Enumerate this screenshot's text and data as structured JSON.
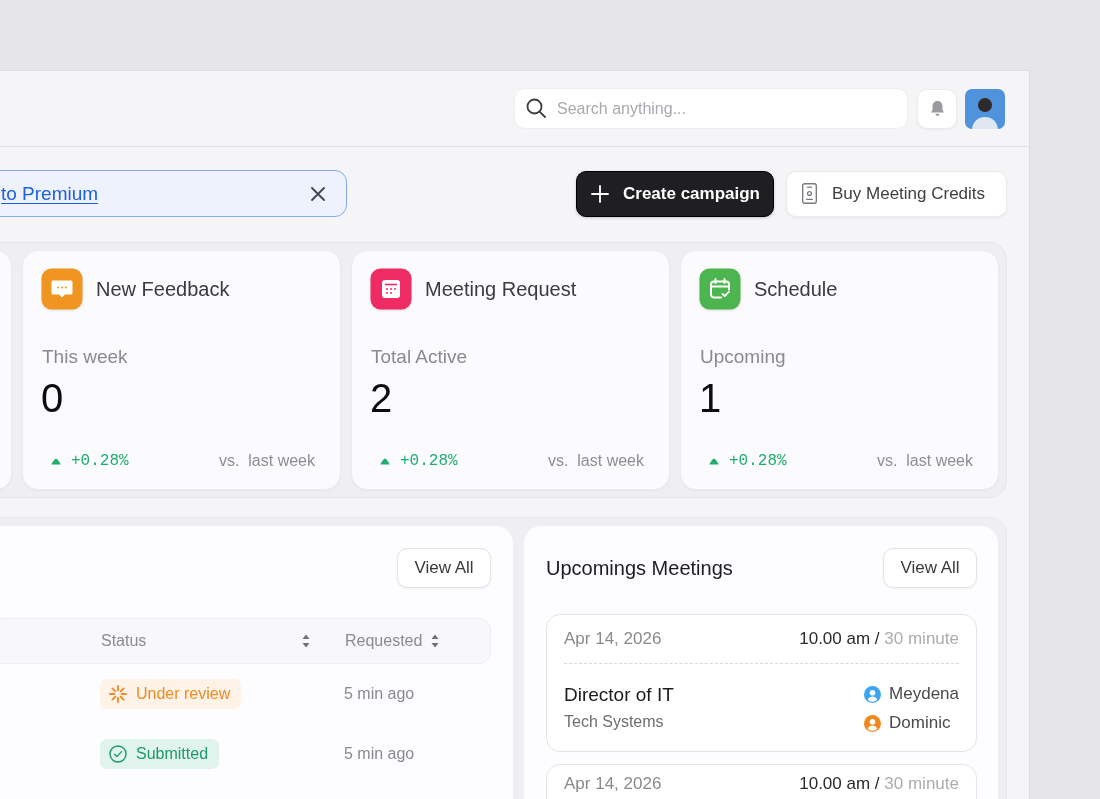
{
  "header": {
    "search": {
      "placeholder": "Search anything..."
    }
  },
  "banner": {
    "link": "to Premium"
  },
  "actions": [
    {
      "kind": "primary",
      "label": "Create campaign"
    },
    {
      "kind": "secondary",
      "label": "Buy Meeting Credits"
    }
  ],
  "stats": [
    {
      "kind": "feedback",
      "color": "#f0951f",
      "title": "New Feedback",
      "label": "This week",
      "value": "0",
      "change": "+0.28%",
      "comparison": "vs.  last week"
    },
    {
      "kind": "calendar",
      "color": "#ee2b63",
      "title": "Meeting Request",
      "label": "Total Active",
      "value": "2",
      "change": "+0.28%",
      "comparison": "vs.  last week"
    },
    {
      "kind": "schedule",
      "color": "#4db54f",
      "title": "Schedule",
      "label": "Upcoming",
      "value": "1",
      "change": "+0.28%",
      "comparison": "vs.  last week"
    }
  ],
  "requests": {
    "view_all": "View All",
    "columns": [
      {
        "label": "Status",
        "sortable": true
      },
      {
        "label": "Requested",
        "sortable": true
      }
    ],
    "rows": [
      {
        "status": {
          "kind": "under_review",
          "label": "Under review"
        },
        "requested": "5 min ago"
      },
      {
        "status": {
          "kind": "submitted",
          "label": "Submitted"
        },
        "requested": "5 min ago"
      }
    ]
  },
  "meetings": {
    "title": "Upcomings Meetings",
    "view_all": "View All",
    "items": [
      {
        "date": "Apr 14, 2026",
        "time": "10.00 am",
        "separator": "/",
        "duration": "30 minute",
        "title": "Director of IT",
        "company": "Tech Systems",
        "attendees": [
          {
            "name": "Meydena",
            "color": "#3aa5ee"
          },
          {
            "name": "Dominic",
            "color": "#f0891c"
          }
        ]
      },
      {
        "date": "Apr 14, 2026",
        "time": "10.00 am",
        "separator": "/",
        "duration": "30 minute"
      }
    ]
  }
}
